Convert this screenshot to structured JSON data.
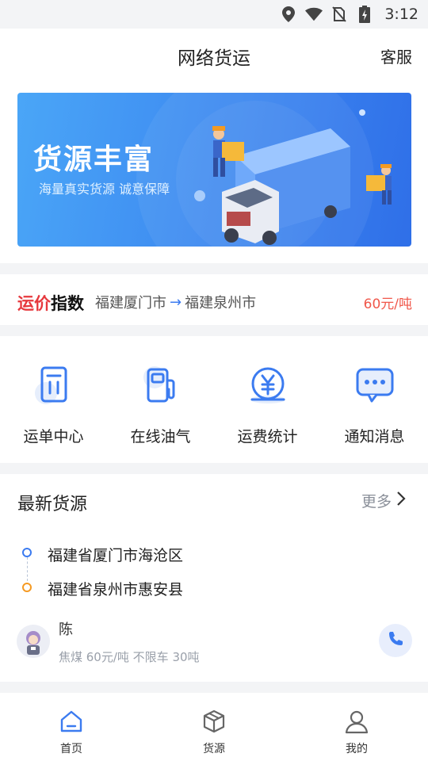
{
  "status_bar": {
    "time": "3:12"
  },
  "header": {
    "title": "网络货运",
    "service": "客服"
  },
  "banner": {
    "title": "货源丰富",
    "subtitle": "海量真实货源  诚意保障"
  },
  "freight_index": {
    "brand_part1": "运价",
    "brand_part2": "指数",
    "from": "福建厦门市",
    "arrow": "→",
    "to": "福建泉州市",
    "price": "60元/吨"
  },
  "quick_actions": [
    {
      "label": "运单中心",
      "icon": "waybill-icon"
    },
    {
      "label": "在线油气",
      "icon": "fuel-pump-icon"
    },
    {
      "label": "运费统计",
      "icon": "yuan-coin-icon"
    },
    {
      "label": "通知消息",
      "icon": "message-icon"
    }
  ],
  "latest": {
    "title": "最新货源",
    "more": "更多",
    "from_address": "福建省厦门市海沧区",
    "to_address": "福建省泉州市惠安县",
    "shipper_name": "陈",
    "detail": "焦煤 60元/吨 不限车 30吨"
  },
  "tabs": [
    {
      "label": "首页",
      "icon": "home-icon"
    },
    {
      "label": "货源",
      "icon": "box-icon"
    },
    {
      "label": "我的",
      "icon": "user-icon"
    }
  ],
  "colors": {
    "accent": "#3b7bf0",
    "price": "#f0574a",
    "brand_red": "#e6383d",
    "origin_dot": "#3b7bf0",
    "destination_dot": "#f59a23"
  }
}
